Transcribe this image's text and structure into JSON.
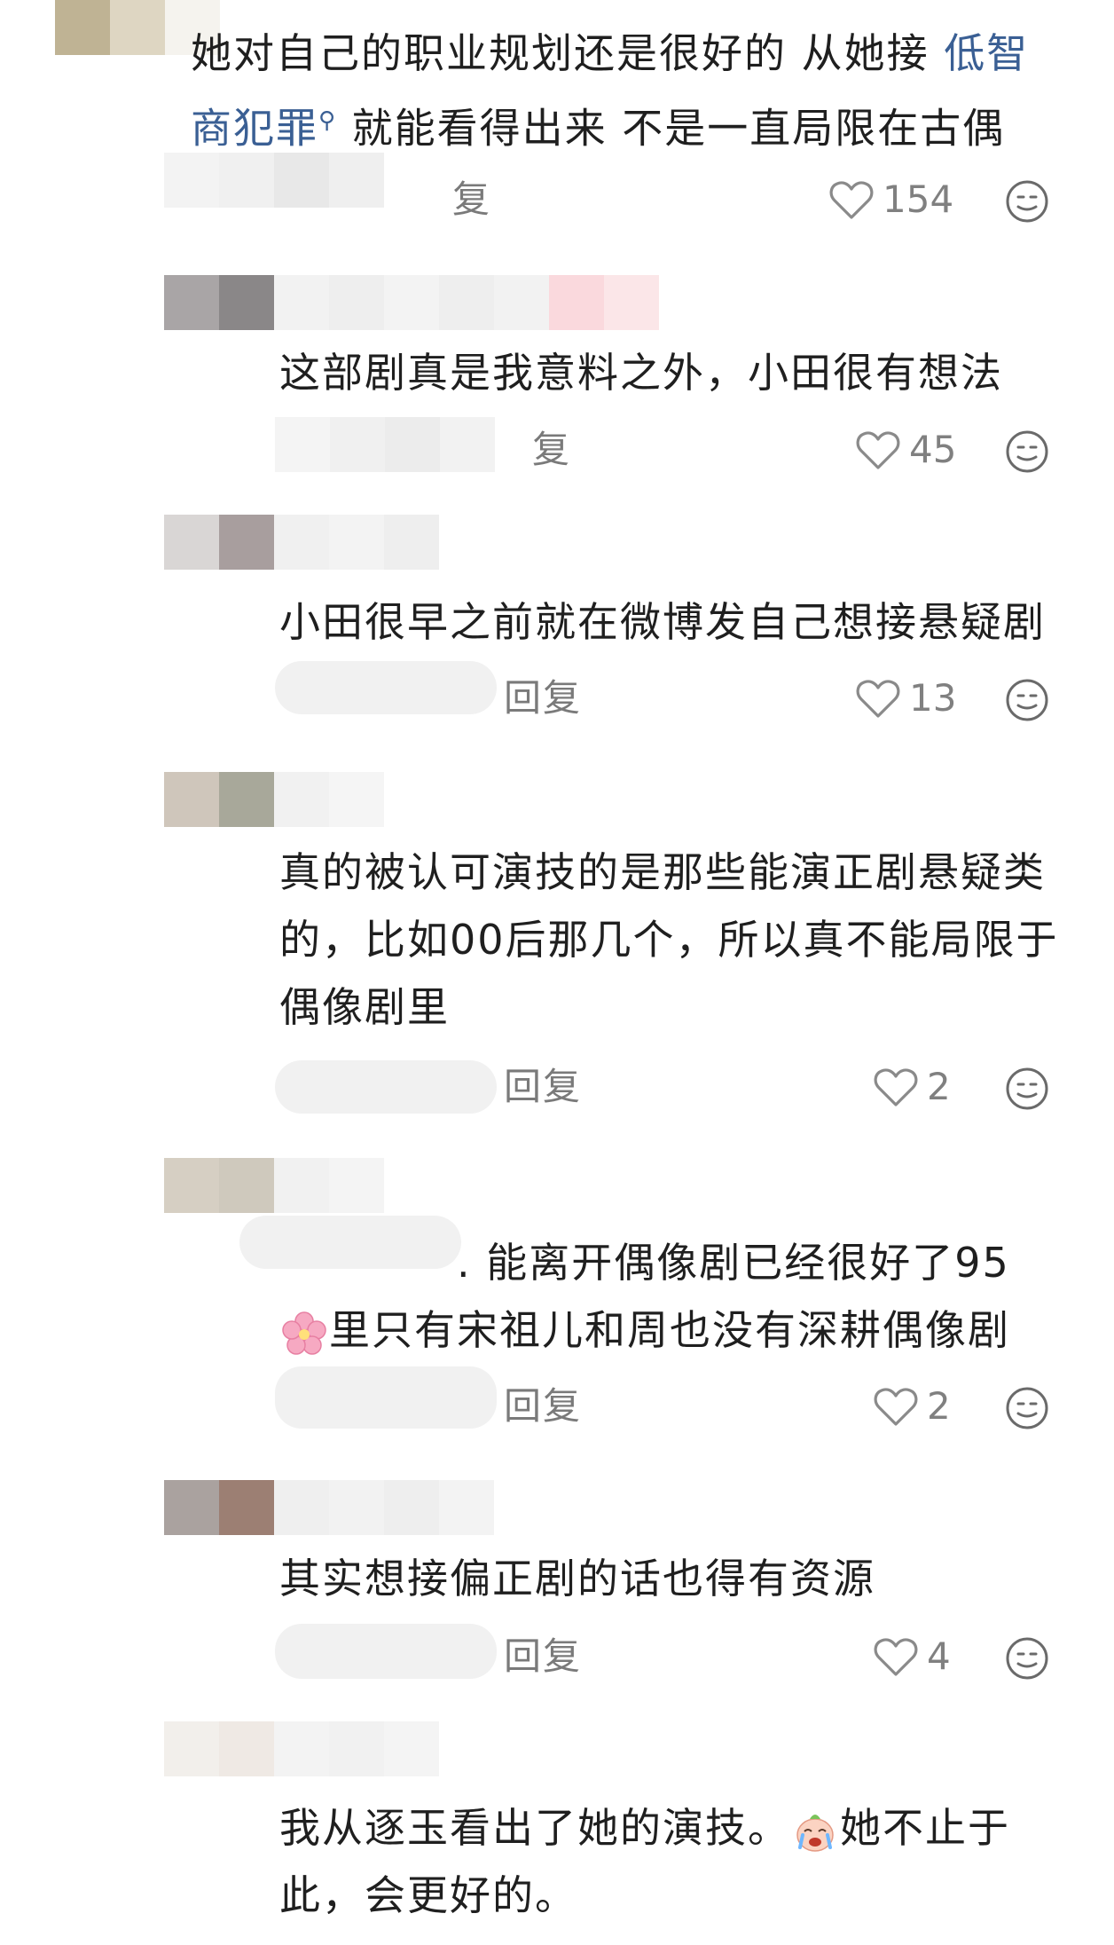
{
  "comments": [
    {
      "lines": [
        "她对自己的职业规划还是很好的 从她接 ",
        "就能看得出来 不是一直局限在古偶"
      ],
      "link_text_1": "低智",
      "link_text_2": "商犯罪",
      "reply_partial": "复",
      "likes": "154"
    },
    {
      "lines": [
        "这部剧真是我意料之外，小田很有想法"
      ],
      "reply_partial": "复",
      "likes": "45"
    },
    {
      "lines": [
        "小田很早之前就在微博发自己想接悬疑剧"
      ],
      "reply": "回复",
      "likes": "13"
    },
    {
      "lines": [
        "真的被认可演技的是那些能演正剧悬疑类",
        "的，比如00后那几个，所以真不能局限于",
        "偶像剧里"
      ],
      "reply": "回复",
      "likes": "2"
    },
    {
      "lines": [
        ". 能离开偶像剧已经很好了95",
        "里只有宋祖儿和周也没有深耕偶像剧"
      ],
      "reply": "回复",
      "likes": "2"
    },
    {
      "lines": [
        "其实想接偏正剧的话也得有资源"
      ],
      "reply": "回复",
      "likes": "4"
    },
    {
      "lines": [
        "我从逐玉看出了她的演技。",
        "她不止于",
        "此，会更好的。"
      ]
    }
  ],
  "icons": {
    "like": "heart-outline-icon",
    "emoji": "smile-face-icon",
    "search": "search-icon",
    "flower": "cherry-blossom-emoji",
    "cry": "crying-emoji"
  },
  "colors": {
    "link": "#3a5f94",
    "muted": "#808080",
    "text": "#1f1f1f"
  }
}
